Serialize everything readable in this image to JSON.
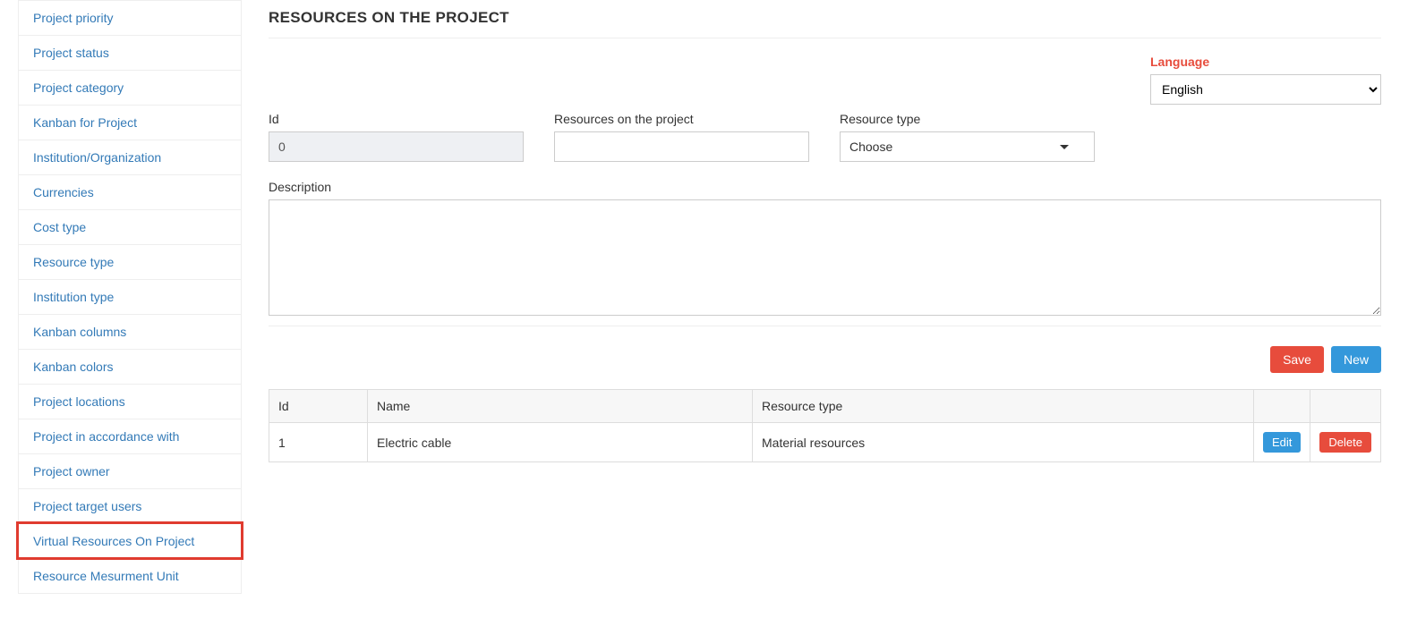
{
  "sidebar": {
    "items": [
      {
        "label": "Project priority",
        "highlight": false
      },
      {
        "label": "Project status",
        "highlight": false
      },
      {
        "label": "Project category",
        "highlight": false
      },
      {
        "label": "Kanban for Project",
        "highlight": false
      },
      {
        "label": "Institution/Organization",
        "highlight": false
      },
      {
        "label": "Currencies",
        "highlight": false
      },
      {
        "label": "Cost type",
        "highlight": false
      },
      {
        "label": "Resource type",
        "highlight": false
      },
      {
        "label": "Institution type",
        "highlight": false
      },
      {
        "label": "Kanban columns",
        "highlight": false
      },
      {
        "label": "Kanban colors",
        "highlight": false
      },
      {
        "label": "Project locations",
        "highlight": false
      },
      {
        "label": "Project in accordance with",
        "highlight": false
      },
      {
        "label": "Project owner",
        "highlight": false
      },
      {
        "label": "Project target users",
        "highlight": false
      },
      {
        "label": "Virtual Resources On Project",
        "highlight": true
      },
      {
        "label": "Resource Mesurment Unit",
        "highlight": false
      }
    ]
  },
  "page": {
    "title": "RESOURCES ON THE PROJECT"
  },
  "language": {
    "label": "Language",
    "selected": "English"
  },
  "form": {
    "id_label": "Id",
    "id_value": "0",
    "name_label": "Resources on the project",
    "name_value": "",
    "type_label": "Resource type",
    "type_value": "Choose",
    "desc_label": "Description",
    "desc_value": ""
  },
  "buttons": {
    "save": "Save",
    "new": "New",
    "edit": "Edit",
    "delete": "Delete"
  },
  "table": {
    "headers": {
      "id": "Id",
      "name": "Name",
      "type": "Resource type"
    },
    "rows": [
      {
        "id": "1",
        "name": "Electric cable",
        "type": "Material resources"
      }
    ]
  }
}
